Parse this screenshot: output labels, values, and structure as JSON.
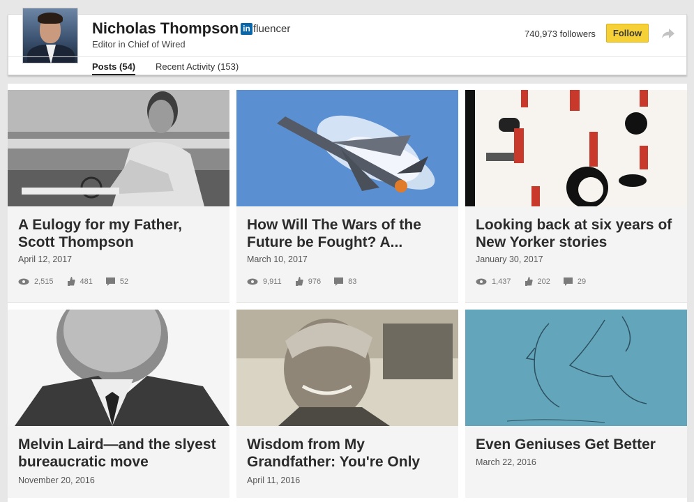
{
  "profile": {
    "name": "Nicholas Thompson",
    "badge_in": "in",
    "badge_text": "fluencer",
    "subtitle": "Editor in Chief of Wired",
    "followers": "740,973 followers",
    "follow_label": "Follow"
  },
  "tabs": [
    {
      "label": "Posts (54)",
      "active": true
    },
    {
      "label": "Recent Activity (153)",
      "active": false
    }
  ],
  "colors": {
    "follow_button": "#f5d036",
    "linkedin_blue": "#0a66a6",
    "card_bg": "#f4f4f4"
  },
  "posts": [
    {
      "title": "A Eulogy for my Father, Scott Thompson",
      "date": "April 12, 2017",
      "views": "2,515",
      "likes": "481",
      "comments": "52",
      "image": "black-and-white photo of man at desk"
    },
    {
      "title": "How Will The Wars of the Future be Fought? A...",
      "date": "March 10, 2017",
      "views": "9,911",
      "likes": "976",
      "comments": "83",
      "image": "fighter jet in blue sky"
    },
    {
      "title": "Looking back at six years of New Yorker stories",
      "date": "January 30, 2017",
      "views": "1,437",
      "likes": "202",
      "comments": "29",
      "image": "cartoon illustrations"
    },
    {
      "title": "Melvin Laird—and the slyest bureaucratic move",
      "date": "November 20, 2016",
      "image": "black-and-white portrait of man in suit"
    },
    {
      "title": "Wisdom from My Grandfather: You're Only",
      "date": "April 11, 2016",
      "image": "vintage photo of smiling man"
    },
    {
      "title": "Even Geniuses Get Better",
      "date": "March 22, 2016",
      "image": "sketch of faces on teal background"
    }
  ]
}
